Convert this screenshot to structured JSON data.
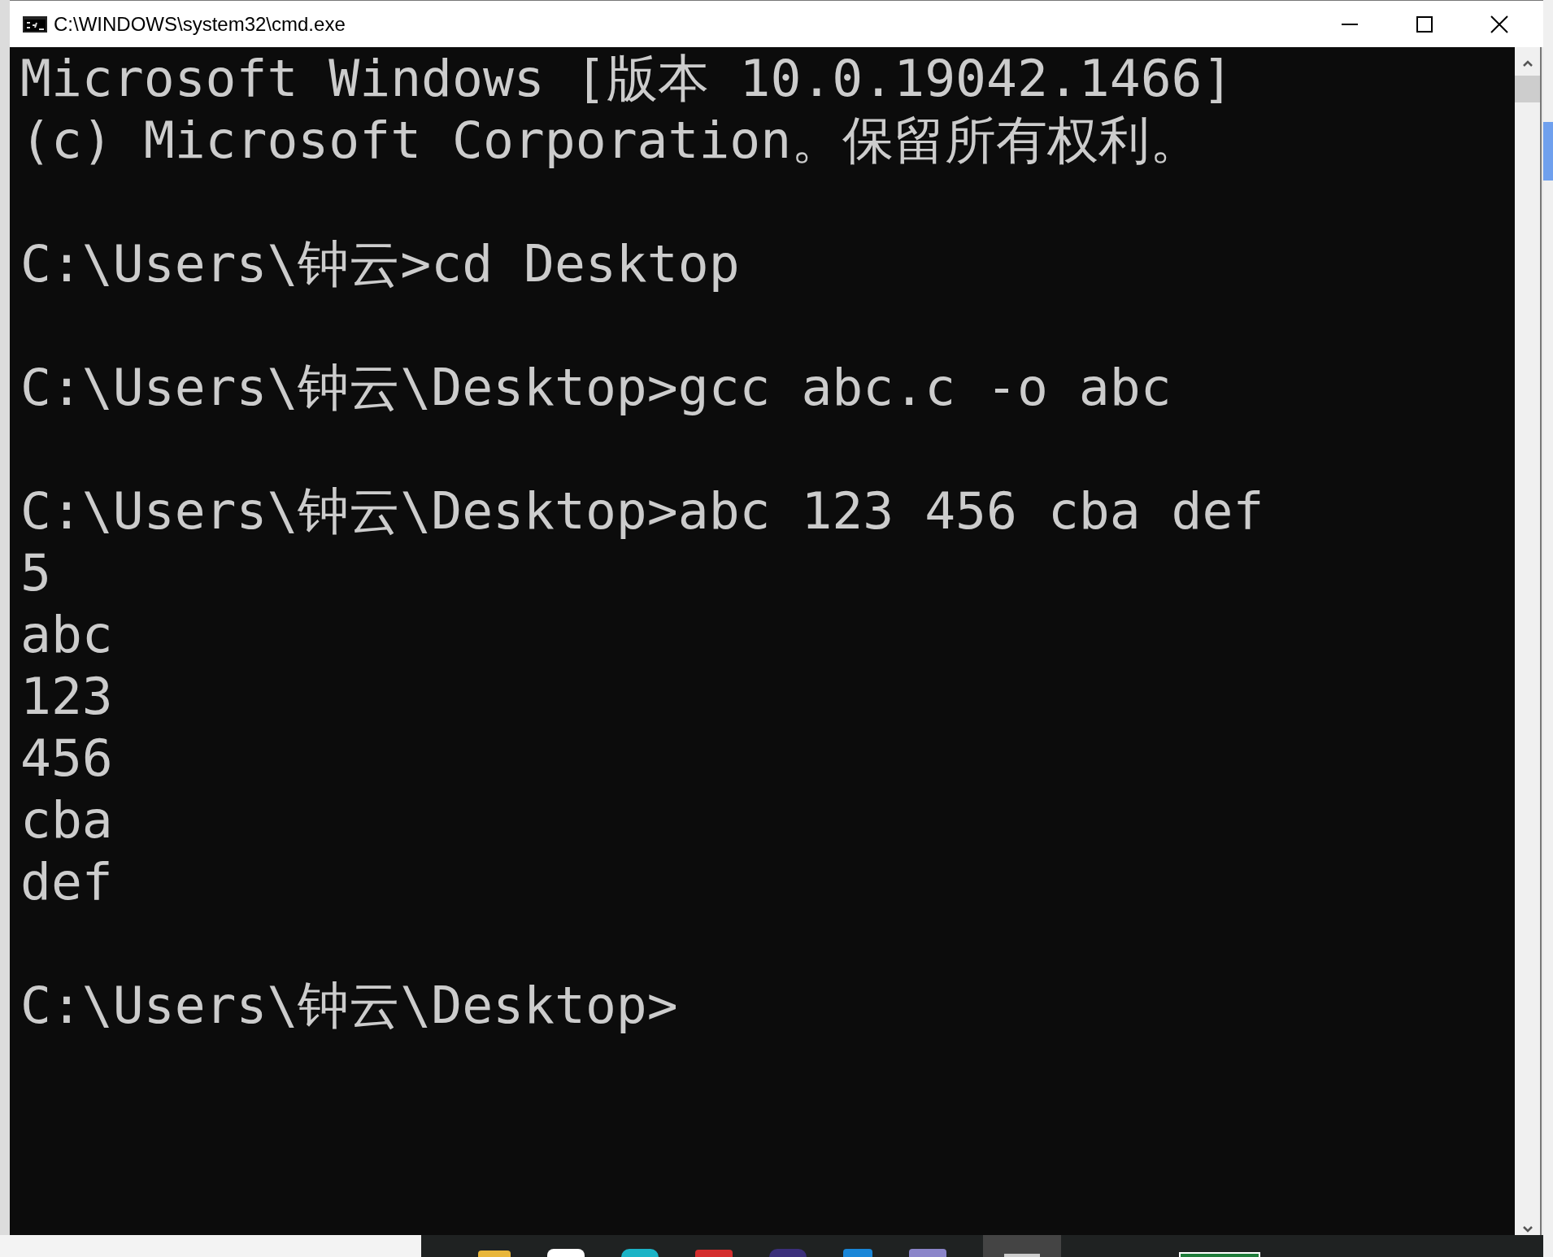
{
  "window": {
    "title": "C:\\WINDOWS\\system32\\cmd.exe"
  },
  "console": {
    "blocks": [
      [
        "Microsoft Windows [版本 10.0.19042.1466]",
        "(c) Microsoft Corporation。保留所有权利。"
      ],
      [
        "C:\\Users\\钟云>cd Desktop"
      ],
      [
        "C:\\Users\\钟云\\Desktop>gcc abc.c -o abc"
      ],
      [
        "C:\\Users\\钟云\\Desktop>abc 123 456 cba def",
        "5",
        "abc",
        "123",
        "456",
        "cba",
        "def"
      ],
      [
        "C:\\Users\\钟云\\Desktop>"
      ]
    ]
  }
}
